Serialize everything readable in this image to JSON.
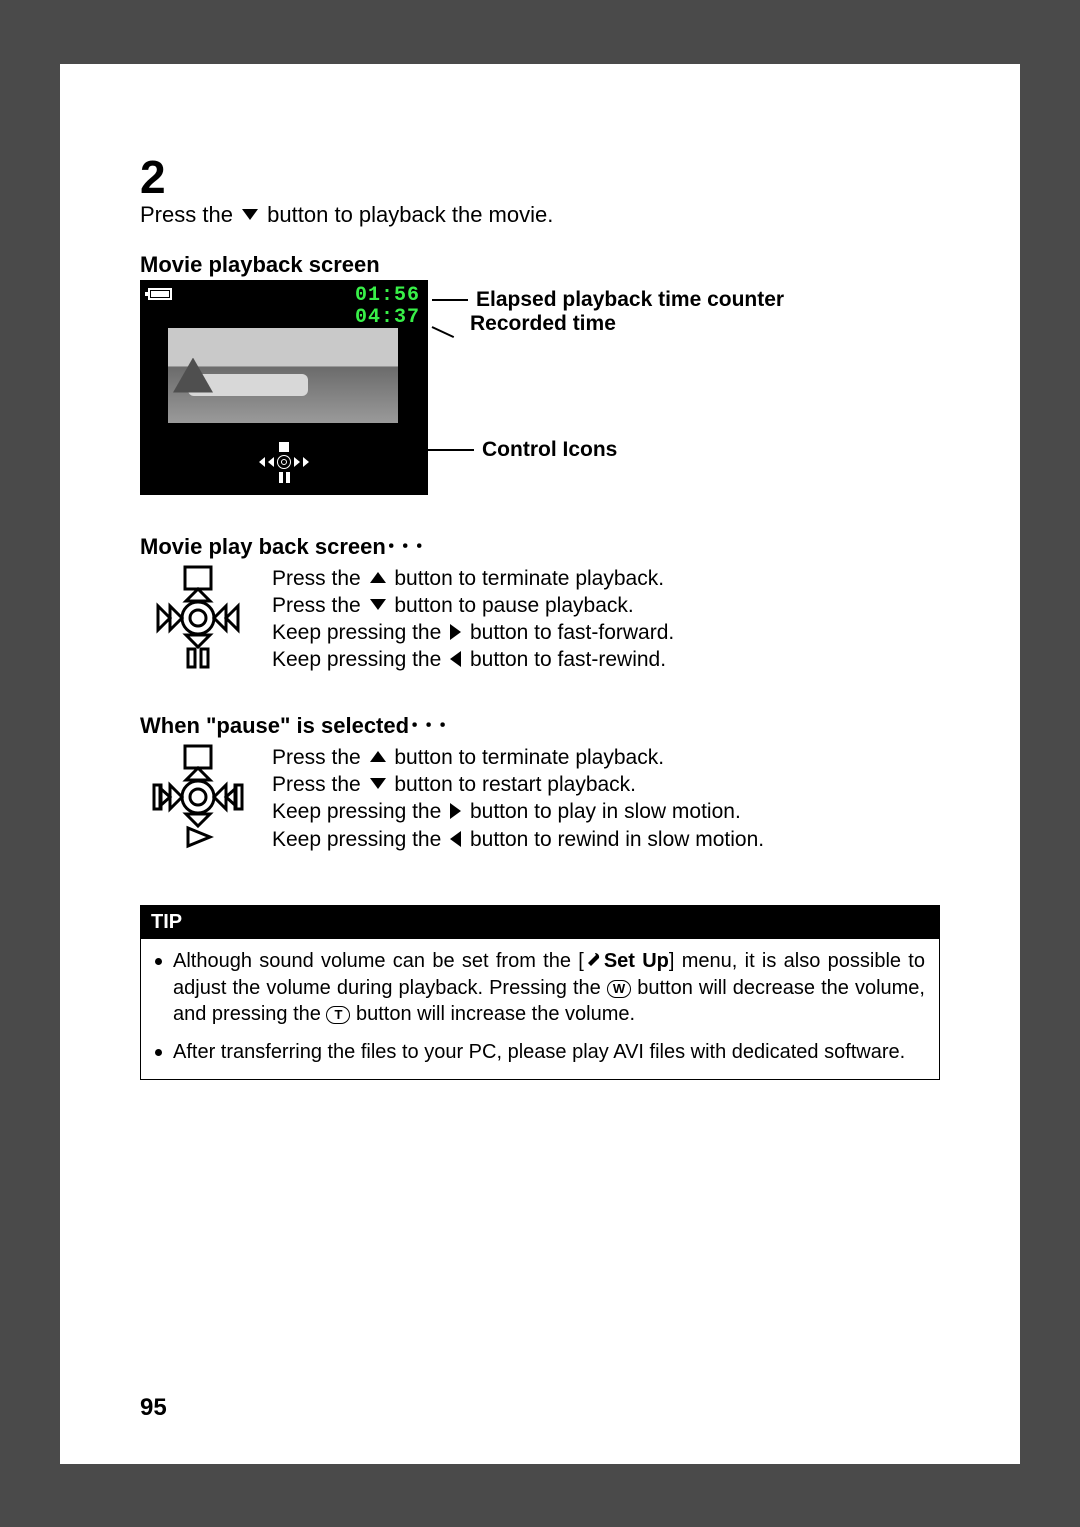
{
  "step": {
    "number": "2",
    "instruction_pre": "Press the ",
    "instruction_post": " button to playback the movie."
  },
  "screen": {
    "heading": "Movie playback screen",
    "elapsed_time": "01:56",
    "recorded_time": "04:37",
    "labels": {
      "elapsed": "Elapsed playback time counter",
      "recorded": "Recorded time",
      "controls": "Control Icons"
    }
  },
  "playback": {
    "heading": "Movie play back screen",
    "dots": "･･･",
    "l1_pre": "Press the ",
    "l1_post": " button to terminate playback.",
    "l2_pre": "Press the ",
    "l2_post": " button to pause playback.",
    "l3_pre": "Keep pressing the ",
    "l3_post": " button to fast-forward.",
    "l4_pre": "Keep pressing the ",
    "l4_post": " button to fast-rewind."
  },
  "pause": {
    "heading": "When \"pause\" is selected",
    "dots": "･･･",
    "l1_pre": "Press the ",
    "l1_post": " button to terminate playback.",
    "l2_pre": "Press the ",
    "l2_post": " button to restart playback.",
    "l3_pre": "Keep pressing the ",
    "l3_post": " button to play in slow motion.",
    "l4_pre": "Keep pressing the ",
    "l4_post": " button to rewind in slow motion."
  },
  "tip": {
    "heading": "TIP",
    "item1_a": "Although sound volume can be set from the [",
    "item1_setup": "Set Up",
    "item1_b": "] menu, it is also possible to adjust the volume during playback. Pressing the ",
    "item1_c": " button will decrease the volume, and pressing the ",
    "item1_d": " button will increase the volume.",
    "key_w": "W",
    "key_t": "T",
    "item2": "After transferring the files to your PC, please play AVI files with dedicated software."
  },
  "page_number": "95"
}
